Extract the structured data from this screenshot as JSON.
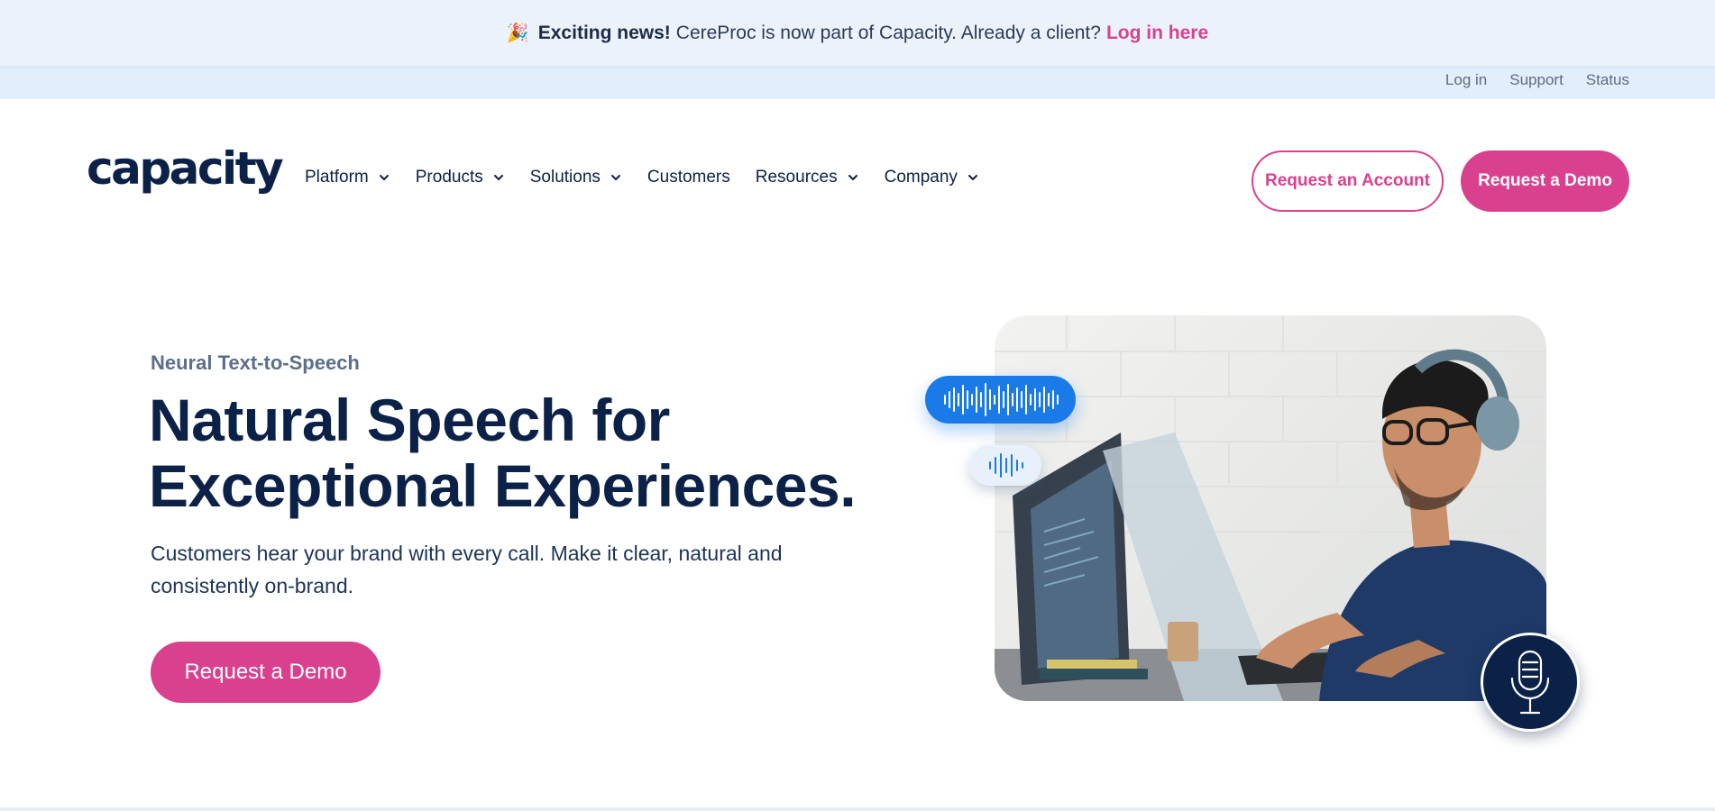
{
  "announcement": {
    "emoji": "🎉",
    "bold": "Exciting news!",
    "text": "CereProc is now part of Capacity. Already a client?",
    "link": "Log in here"
  },
  "utility_links": [
    "Log in",
    "Support",
    "Status"
  ],
  "brand": {
    "logo_text": "capacity",
    "accent_color": "#d9418f",
    "navy_color": "#0b2148"
  },
  "nav": {
    "items": [
      {
        "label": "Platform",
        "has_dropdown": true
      },
      {
        "label": "Products",
        "has_dropdown": true
      },
      {
        "label": "Solutions",
        "has_dropdown": true
      },
      {
        "label": "Customers",
        "has_dropdown": false
      },
      {
        "label": "Resources",
        "has_dropdown": true
      },
      {
        "label": "Company",
        "has_dropdown": true
      }
    ],
    "request_account": "Request an Account",
    "request_demo": "Request a Demo"
  },
  "hero": {
    "eyebrow": "Neural Text-to-Speech",
    "headline_line1": "Natural Speech for",
    "headline_line2": "Exceptional Experiences.",
    "subtext": "Customers hear your brand with every call. Make it clear, natural and consistently on-brand.",
    "cta": "Request a Demo"
  },
  "icons": {
    "waveform_large": "waveform-icon",
    "waveform_small": "waveform-icon",
    "microphone": "microphone-icon",
    "chevron": "chevron-down-icon"
  }
}
